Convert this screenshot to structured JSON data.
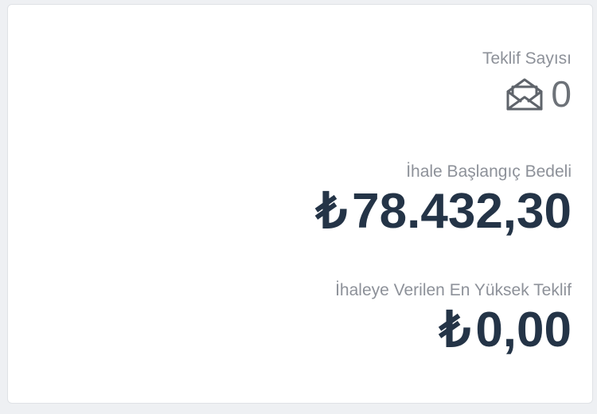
{
  "offer_count": {
    "label": "Teklif Sayısı",
    "value": "0",
    "icon": "envelope-open-icon"
  },
  "starting_price": {
    "label": "İhale Başlangıç Bedeli",
    "currency": "₺",
    "value": "78.432,30"
  },
  "highest_offer": {
    "label": "İhaleye Verilen En Yüksek Teklif",
    "currency": "₺",
    "value": "0,00"
  },
  "colors": {
    "label": "#8d9199",
    "amount": "#243447",
    "count": "#6d7278"
  }
}
